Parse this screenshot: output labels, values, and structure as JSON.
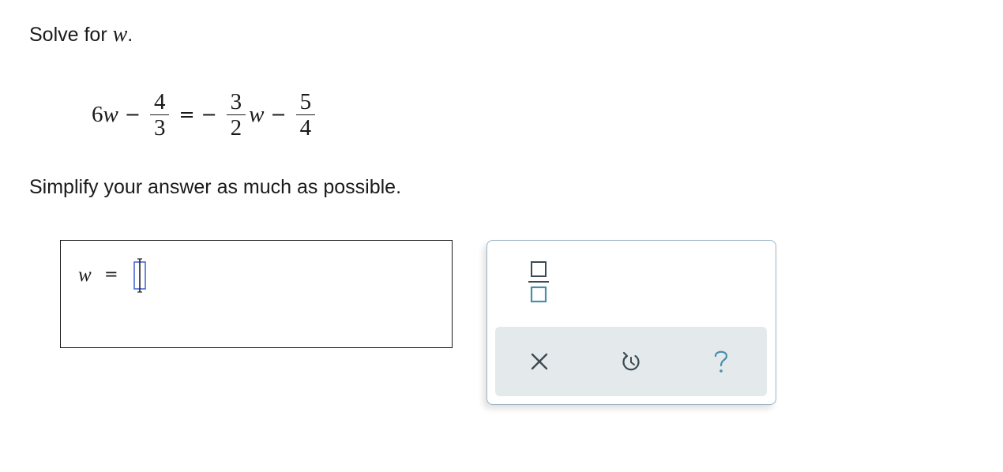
{
  "prompt": {
    "prefix": "Solve for ",
    "variable": "w",
    "suffix": "."
  },
  "equation": {
    "lhs_coef": "6",
    "lhs_var": "w",
    "op_minus_1": "−",
    "frac1": {
      "num": "4",
      "den": "3"
    },
    "equals": "=",
    "op_neg": "−",
    "frac2": {
      "num": "3",
      "den": "2"
    },
    "rhs_var": "w",
    "op_minus_2": "−",
    "frac3": {
      "num": "5",
      "den": "4"
    }
  },
  "instruction": "Simplify your answer as much as possible.",
  "answer": {
    "variable": "w",
    "equals": "=",
    "value": ""
  },
  "palette": {
    "icons": {
      "fraction": "fraction-template-icon",
      "clear": "clear-x-icon",
      "undo": "undo-icon",
      "help": "help-question-icon"
    },
    "colors": {
      "template_blue": "#4a8fa8",
      "tool_gray": "#3c4a52",
      "toolbar_bg": "#e4e9ec",
      "border": "#9db4c4",
      "cursor_box": "#3f5fd0"
    }
  }
}
